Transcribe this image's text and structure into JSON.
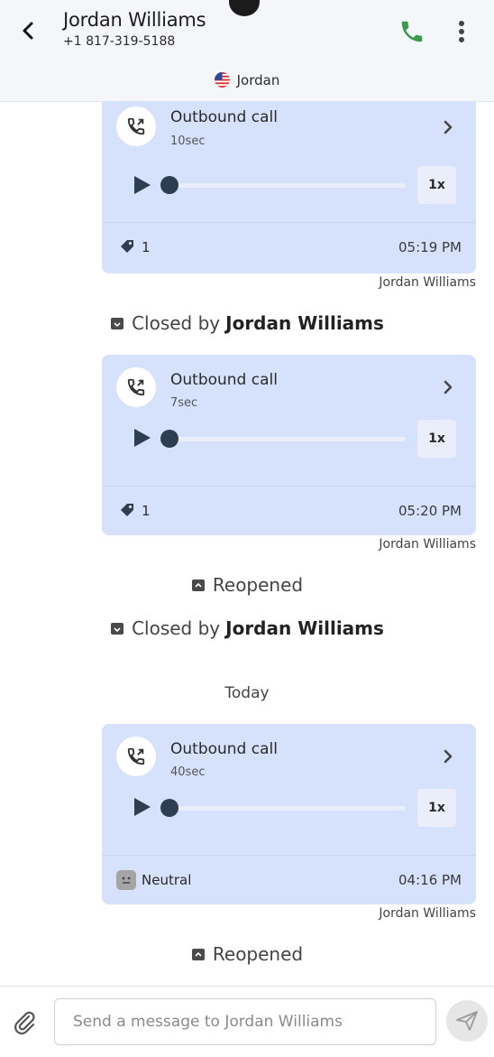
{
  "header": {
    "contact_name": "Jordan Williams",
    "phone": "+1 817-319-5188",
    "channel_label": "Jordan"
  },
  "calls": [
    {
      "title": "Outbound call",
      "duration": "10sec",
      "speed": "1x",
      "tag_count": "1",
      "time": "05:19 PM",
      "sender": "Jordan Williams"
    },
    {
      "title": "Outbound call",
      "duration": "7sec",
      "speed": "1x",
      "tag_count": "1",
      "time": "05:20 PM",
      "sender": "Jordan Williams"
    },
    {
      "title": "Outbound call",
      "duration": "40sec",
      "speed": "1x",
      "sentiment": "Neutral",
      "time": "04:16 PM",
      "sender": "Jordan Williams"
    }
  ],
  "events": {
    "closed_prefix": "Closed by",
    "closed_by": "Jordan Williams",
    "reopened": "Reopened"
  },
  "date_separator": "Today",
  "composer": {
    "placeholder": "Send a message to Jordan Williams"
  },
  "colors": {
    "card_bg": "#d6e2fb",
    "call_icon": "#3a9b4a"
  }
}
